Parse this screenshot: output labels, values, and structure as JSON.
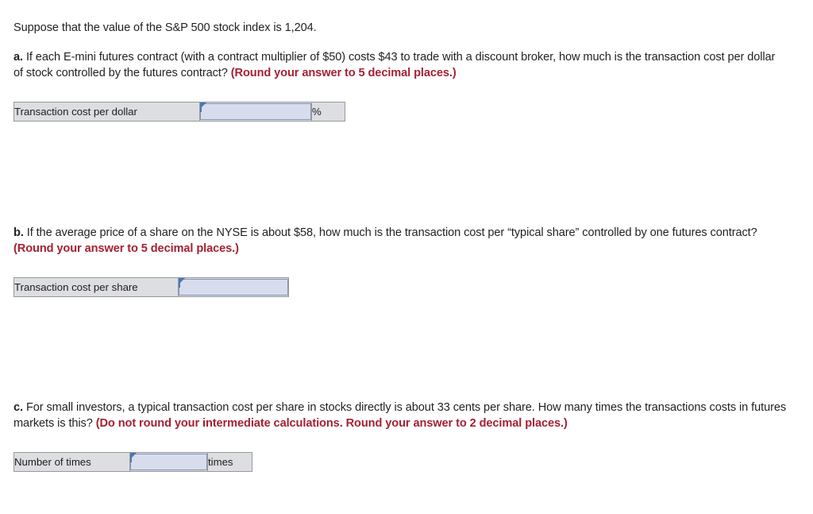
{
  "intro": {
    "text": "Suppose that the value of the S&P 500 stock index is 1,204."
  },
  "questions": [
    {
      "label": "a.",
      "body": " If each E-mini futures contract (with a contract multiplier of $50) costs $43 to trade with a discount broker, how much is the transaction cost per dollar of stock controlled by the futures contract? ",
      "hint": "(Round your answer to 5 decimal places.)",
      "answer_row": {
        "label": "Transaction cost per dollar",
        "value": "",
        "unit": "%"
      }
    },
    {
      "label": "b.",
      "body": " If the average price of a share on the NYSE is about $58, how much is the transaction cost per “typical share” controlled by one futures contract? ",
      "hint": "(Round your answer to 5 decimal places.)",
      "answer_row": {
        "label": "Transaction cost per share",
        "value": "",
        "unit": ""
      }
    },
    {
      "label": "c.",
      "body": " For small investors, a typical transaction cost per share in stocks directly is about 33 cents per share. How many times the transactions costs in futures markets is this? ",
      "hint": "(Do not round your intermediate calculations. Round your answer to 2 decimal places.)",
      "answer_row": {
        "label": "Number of times",
        "value": "",
        "unit": "times"
      }
    }
  ],
  "colors": {
    "hint_red": "#a32232",
    "field_fill": "#d8dded",
    "field_border": "#7d96b8",
    "cell_fill": "#dcdee2",
    "cell_border": "#9a9a9a",
    "caret_blue": "#4a78b5",
    "text": "#231f20"
  }
}
